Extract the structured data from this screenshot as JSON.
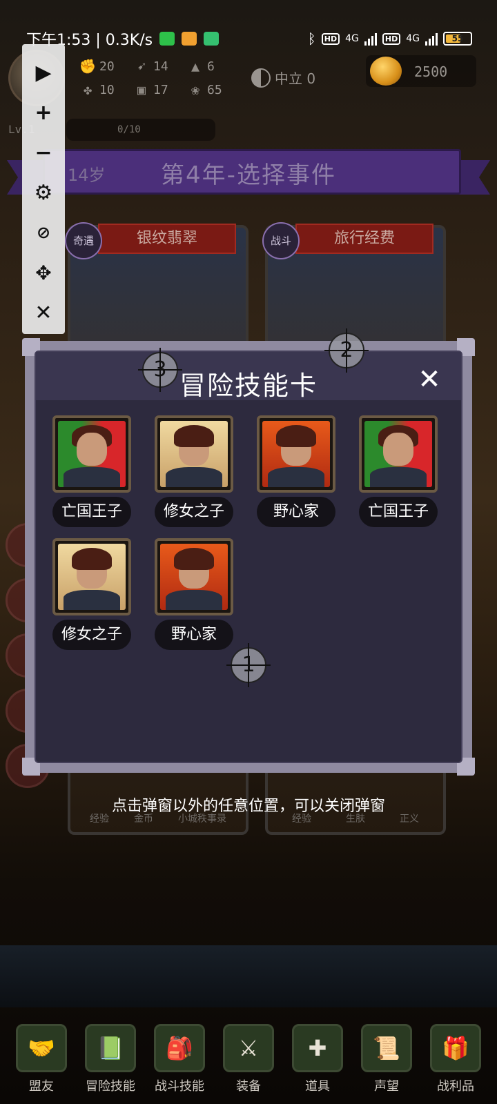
{
  "status_bar": {
    "time_speed": "下午1:53 | 0.3K/s",
    "net1": "4G",
    "net2": "4G",
    "battery": "55"
  },
  "hud": {
    "stats": [
      {
        "icon": "fist-icon",
        "value": "20"
      },
      {
        "icon": "boot-icon",
        "value": "14"
      },
      {
        "icon": "wizard-hat-icon",
        "value": "6"
      },
      {
        "icon": "clover-icon",
        "value": "10"
      },
      {
        "icon": "armor-icon",
        "value": "17"
      },
      {
        "icon": "lotus-icon",
        "value": "65"
      }
    ],
    "alignment": "中立 0",
    "gold": "2500",
    "level": "Lv.1",
    "xp": "0/10"
  },
  "banner": {
    "age": "14岁",
    "title": "第4年-选择事件"
  },
  "event_cards": [
    {
      "tag": "奇遇",
      "name": "银纹翡翠",
      "footer": [
        "经验",
        "金币",
        "小城秩事录"
      ]
    },
    {
      "tag": "战斗",
      "name": "旅行经费",
      "footer": [
        "经验",
        "生肤",
        "正义"
      ]
    }
  ],
  "modal": {
    "title": "冒险技能卡",
    "close": "✕",
    "skills": [
      {
        "name": "亡国王子",
        "portrait": "prince"
      },
      {
        "name": "修女之子",
        "portrait": "nun"
      },
      {
        "name": "野心家",
        "portrait": "amb"
      },
      {
        "name": "亡国王子",
        "portrait": "prince"
      },
      {
        "name": "修女之子",
        "portrait": "nun"
      },
      {
        "name": "野心家",
        "portrait": "amb"
      }
    ],
    "markers": [
      "1",
      "2",
      "3"
    ]
  },
  "hint": "点击弹窗以外的任意位置，可以关闭弹窗",
  "bottom_nav": [
    {
      "label": "盟友",
      "icon": "handshake-icon"
    },
    {
      "label": "冒险技能",
      "icon": "book-icon"
    },
    {
      "label": "战斗技能",
      "icon": "backpack-icon"
    },
    {
      "label": "装备",
      "icon": "swords-icon"
    },
    {
      "label": "道具",
      "icon": "amulet-icon"
    },
    {
      "label": "声望",
      "icon": "scroll-icon"
    },
    {
      "label": "战利品",
      "icon": "chest-icon"
    }
  ],
  "colors": {
    "banner_purple": "#4b2f7a",
    "modal_bg": "#2d2a3e",
    "card_tag_red": "#7a1a14"
  }
}
